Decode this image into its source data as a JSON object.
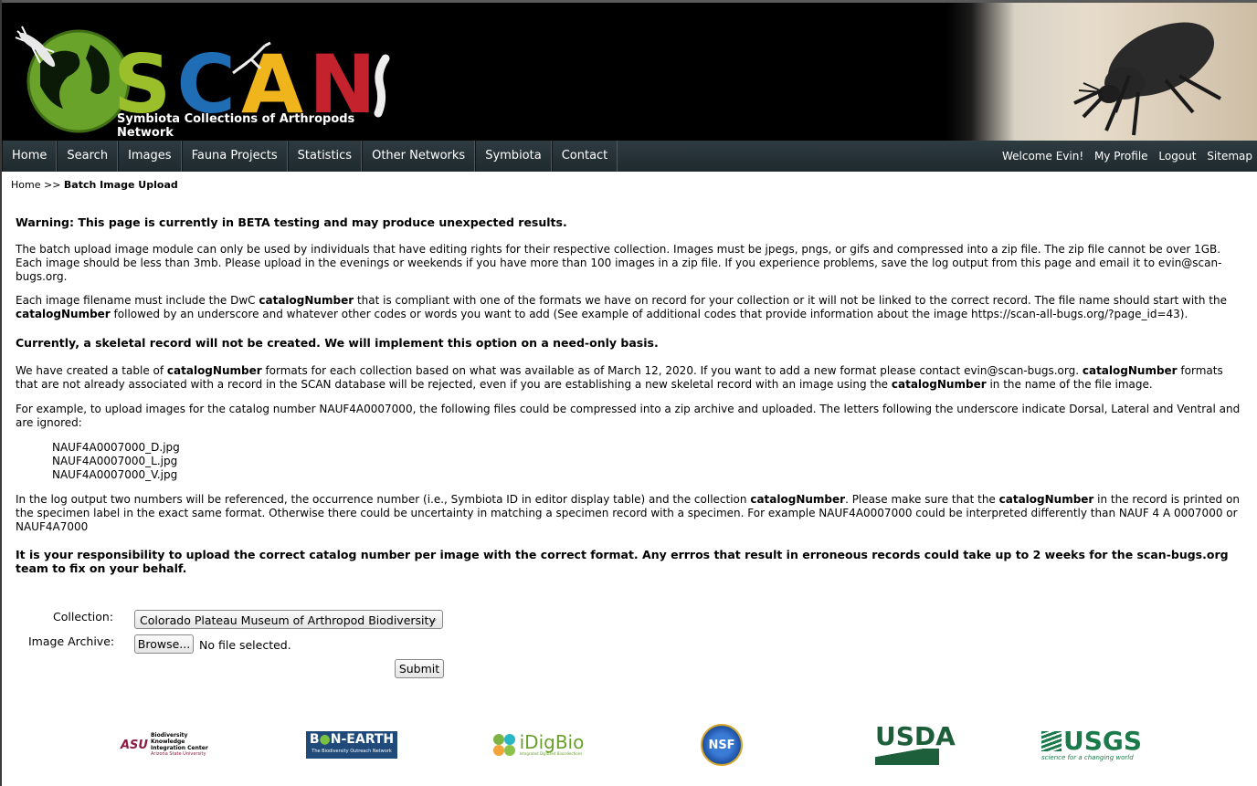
{
  "header": {
    "logo_letters": [
      "S",
      "C",
      "A",
      "N"
    ],
    "logo_subtitle": "Symbiota Collections of Arthropods Network"
  },
  "nav": {
    "items": [
      "Home",
      "Search",
      "Images",
      "Fauna Projects",
      "Statistics",
      "Other Networks",
      "Symbiota",
      "Contact"
    ],
    "welcome": "Welcome Evin!",
    "profile": "My Profile",
    "logout": "Logout",
    "sitemap": "Sitemap"
  },
  "breadcrumb": {
    "home": "Home",
    "sep": ">>",
    "current": "Batch Image Upload"
  },
  "content": {
    "warning": "Warning: This page is currently in BETA testing and may produce unexpected results.",
    "p1": "The batch upload image module can only be used by individuals that have editing rights for their respective collection. Images must be jpegs, pngs, or gifs and compressed into a zip file. The zip file cannot be over 1GB. Each image should be less than 3mb. Please upload in the evenings or weekends if you have more than 100 images in a zip file. If you experience problems, save the log output from this page and email it to evin@scan-bugs.org.",
    "p2_a": "Each image filename must include the DwC ",
    "p2_b": "catalogNumber",
    "p2_c": " that is compliant with one of the formats we have on record for your collection or it will not be linked to the correct record. The file name should start with the ",
    "p2_d": "catalogNumber",
    "p2_e": " followed by an underscore and whatever other codes or words you want to add (See example of additional codes that provide information about the image https://scan-all-bugs.org/?page_id=43).",
    "skeletal": "Currently, a skeletal record will not be created. We will implement this option on a need-only basis.",
    "p3_a": "We have created a table of ",
    "p3_b": "catalogNumber",
    "p3_c": " formats for each collection based on what was available as of March 12, 2020. If you want to add a new format please contact evin@scan-bugs.org. ",
    "p3_d": "catalogNumber",
    "p3_e": " formats that are not already associated with a record in the SCAN database will be rejected, even if you are establishing a new skeletal record with an image using the ",
    "p3_f": "catalogNumber",
    "p3_g": " in the name of the file image.",
    "p4": "For example, to upload images for the catalog number NAUF4A0007000, the following files could be compressed into a zip archive and uploaded. The letters following the underscore indicate Dorsal, Lateral and Ventral and are ignored:",
    "files": [
      "NAUF4A0007000_D.jpg",
      "NAUF4A0007000_L.jpg",
      "NAUF4A0007000_V.jpg"
    ],
    "p5_a": "In the log output two numbers will be referenced, the occurrence number (i.e., Symbiota ID in editor display table) and the collection ",
    "p5_b": "catalogNumber",
    "p5_c": ". Please make sure that the ",
    "p5_d": "catalogNumber",
    "p5_e": " in the record is printed on the specimen label in the exact same format. Otherwise there could be uncertainty in matching a specimen record with a specimen. For example NAUF4A0007000 could be interpreted differently than NAUF 4 A 0007000 or NAUF4A7000",
    "responsibility": "It is your responsibility to upload the correct catalog number per image with the correct format. Any errros that result in erroneous records could take up to 2 weeks for the scan-bugs.org team to fix on your behalf."
  },
  "form": {
    "collection_label": "Collection:",
    "collection_value": "Colorado Plateau Museum of Arthropod Biodiversity",
    "archive_label": "Image Archive:",
    "browse_label": "Browse...",
    "no_file": "No file selected.",
    "submit_label": "Submit"
  },
  "footer": {
    "asu_line1": "Biodiversity Knowledge",
    "asu_line2": "Integration Center",
    "asu_line3": "Arizona State University",
    "bonearth": "B",
    "bonearth2": "N-EARTH",
    "bonearth_sub": "The Biodiversity Outreach Network",
    "idigbio": "iDigBio",
    "idigbio_sub": "Integrated Digitized Biocollections",
    "nsf": "NSF",
    "usda": "USDA",
    "usgs": "USGS",
    "usgs_sub": "science for a changing world"
  }
}
